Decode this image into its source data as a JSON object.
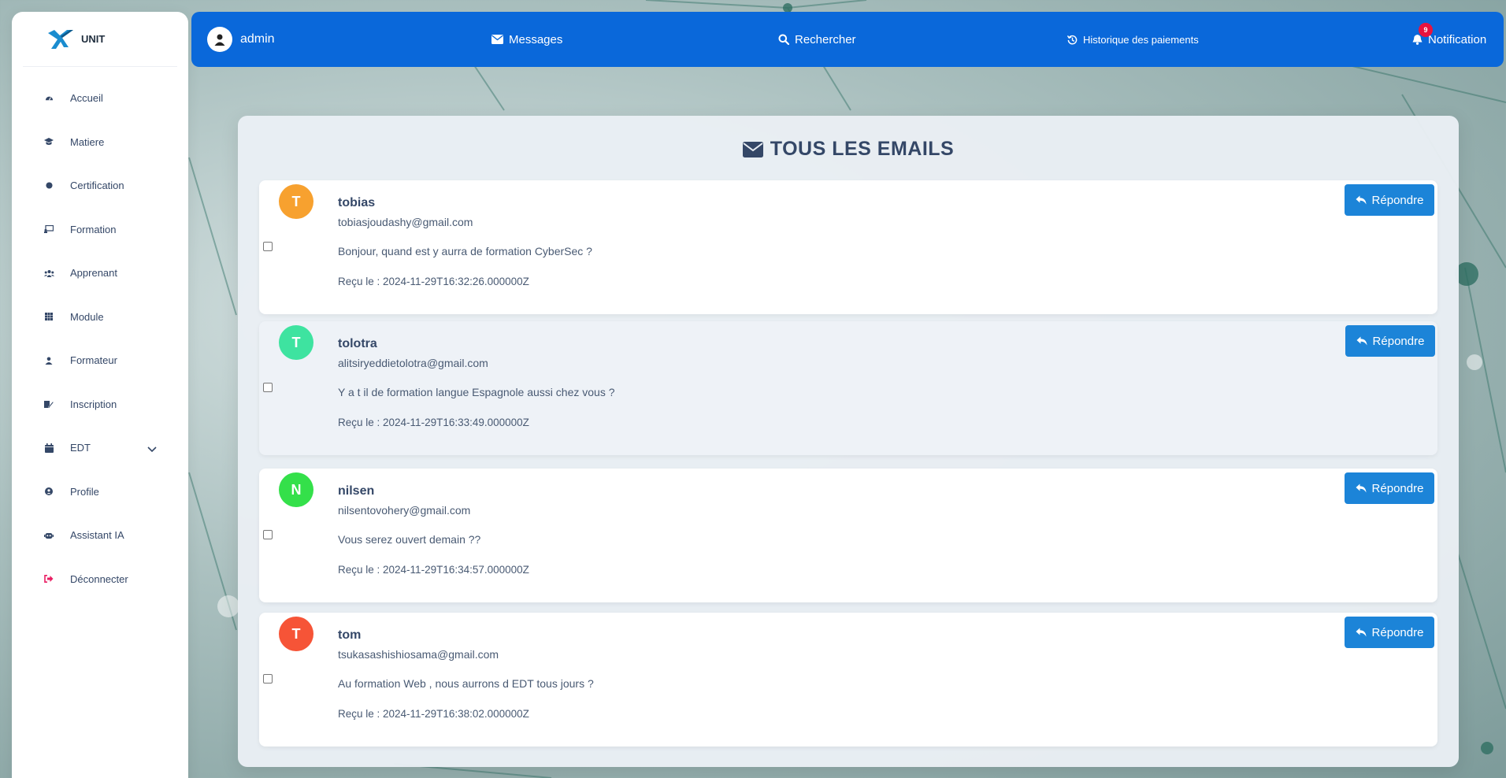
{
  "brand": {
    "name": "UNIT"
  },
  "sidebar": {
    "items": [
      {
        "label": "Accueil",
        "icon": "dashboard-icon"
      },
      {
        "label": "Matiere",
        "icon": "graduation-cap-icon"
      },
      {
        "label": "Certification",
        "icon": "circle-icon"
      },
      {
        "label": "Formation",
        "icon": "chalkboard-icon"
      },
      {
        "label": "Apprenant",
        "icon": "users-icon"
      },
      {
        "label": "Module",
        "icon": "grid-icon"
      },
      {
        "label": "Formateur",
        "icon": "user-icon"
      },
      {
        "label": "Inscription",
        "icon": "edit-icon"
      },
      {
        "label": "EDT",
        "icon": "calendar-icon"
      },
      {
        "label": "Profile",
        "icon": "user-circle-icon"
      },
      {
        "label": "Assistant IA",
        "icon": "robot-icon"
      },
      {
        "label": "Déconnecter",
        "icon": "logout-icon"
      }
    ]
  },
  "topbar": {
    "user": "admin",
    "messages": "Messages",
    "search": "Rechercher",
    "history": "Historique des paiements",
    "notification": "Notification",
    "notification_count": "9"
  },
  "main": {
    "title": "TOUS LES EMAILS",
    "reply_label": "Répondre",
    "emails": [
      {
        "initial": "T",
        "name": "tobias",
        "email": "tobiasjoudashy@gmail.com",
        "message": "Bonjour, quand est y aurra de formation CyberSec ?",
        "received": "Reçu le : 2024-11-29T16:32:26.000000Z",
        "color": "#f7a12f"
      },
      {
        "initial": "T",
        "name": "tolotra",
        "email": "alitsiryeddietolotra@gmail.com",
        "message": "Y a t il de formation langue Espagnole aussi chez vous ?",
        "received": "Reçu le : 2024-11-29T16:33:49.000000Z",
        "color": "#3ee3a0"
      },
      {
        "initial": "N",
        "name": "nilsen",
        "email": "nilsentovohery@gmail.com",
        "message": "Vous serez ouvert demain ??",
        "received": "Reçu le : 2024-11-29T16:34:57.000000Z",
        "color": "#34e04a"
      },
      {
        "initial": "T",
        "name": "tom",
        "email": "tsukasashishiosama@gmail.com",
        "message": "Au formation Web , nous aurrons d EDT tous jours ?",
        "received": "Reçu le : 2024-11-29T16:38:02.000000Z",
        "color": "#f65437"
      }
    ]
  },
  "colors": {
    "topbar": "#0a68da",
    "reply_button": "#1c84d8",
    "badge": "#e8133f"
  }
}
